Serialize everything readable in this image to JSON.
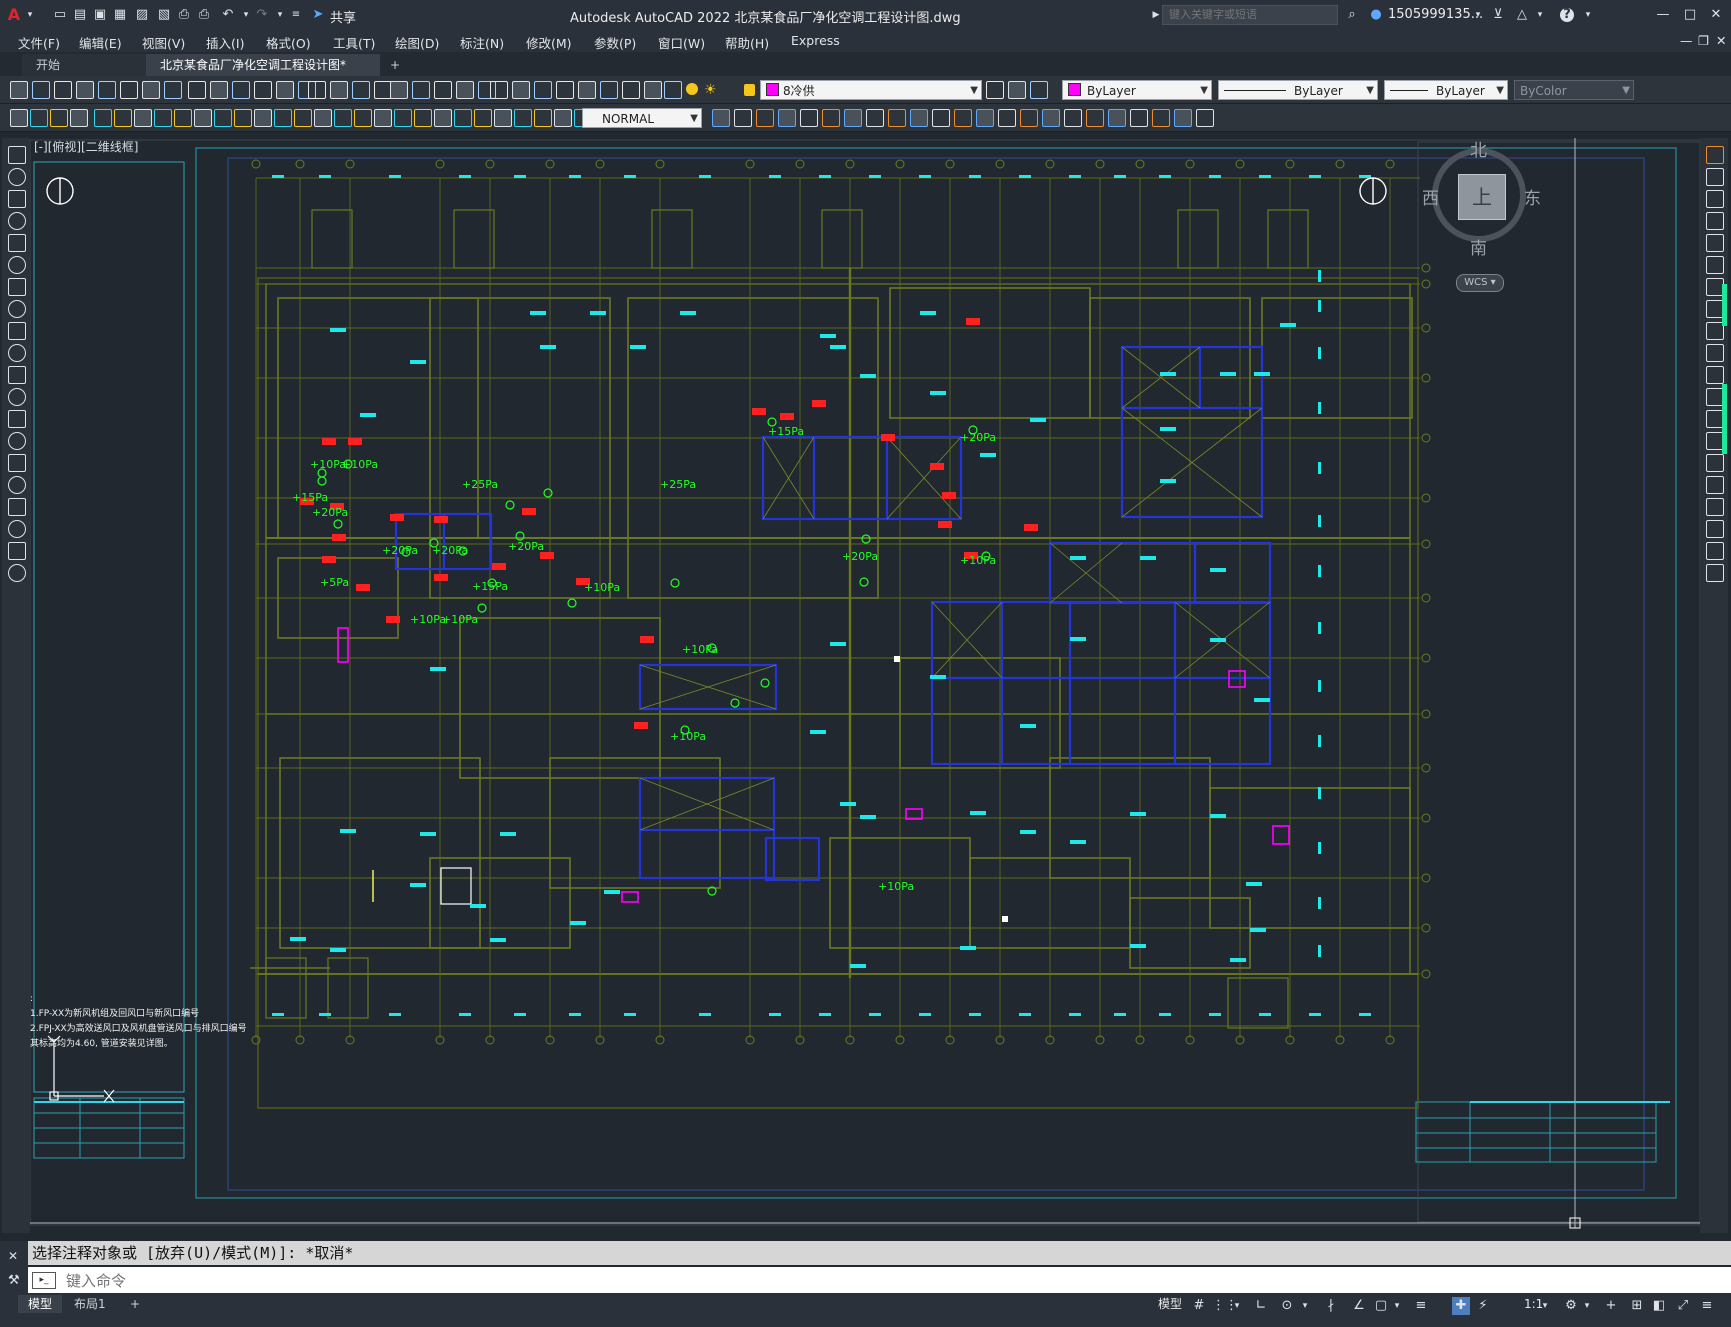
{
  "app": {
    "title": "Autodesk AutoCAD 2022    北京某食品厂净化空调工程设计图.dwg",
    "share_label": "共享",
    "search_placeholder": "键入关键字或短语",
    "user": "1505999135...",
    "accent": "#e0242b"
  },
  "menu": [
    "文件(F)",
    "编辑(E)",
    "视图(V)",
    "插入(I)",
    "格式(O)",
    "工具(T)",
    "绘图(D)",
    "标注(N)",
    "修改(M)",
    "参数(P)",
    "窗口(W)",
    "帮助(H)",
    "Express"
  ],
  "tabs": [
    {
      "label": "开始",
      "active": false
    },
    {
      "label": "北京某食品厂净化空调工程设计图*",
      "active": true
    }
  ],
  "layers_toolbar": {
    "layer": "8冷供",
    "color": "ByLayer",
    "linetype": "ByLayer",
    "lineweight": "ByLayer",
    "plotstyle": "ByColor"
  },
  "dimstyle": "NORMAL",
  "viewport_label": "[-][俯视][二维线框]",
  "viewcube": {
    "north": "北",
    "south": "南",
    "east": "东",
    "west": "西",
    "top": "上",
    "wcs": "WCS"
  },
  "drawing": {
    "pressures": [
      {
        "v": "+10Pa"
      },
      {
        "v": "+10Pa"
      },
      {
        "v": "+15Pa"
      },
      {
        "v": "+20Pa"
      },
      {
        "v": "+25Pa"
      },
      {
        "v": "+25Pa"
      },
      {
        "v": "+20Pa"
      },
      {
        "v": "+20Pa"
      },
      {
        "v": "+20Pa"
      },
      {
        "v": "+15Pa"
      },
      {
        "v": "+5Pa"
      },
      {
        "v": "+10Pa"
      },
      {
        "v": "+10Pa"
      },
      {
        "v": "+10Pa"
      },
      {
        "v": "+20Pa"
      },
      {
        "v": "+15Pa"
      },
      {
        "v": "+20Pa"
      },
      {
        "v": "+10Pa"
      },
      {
        "v": "+10Pa"
      },
      {
        "v": "+10Pa"
      },
      {
        "v": "+10Pa"
      }
    ],
    "notes": [
      ":",
      "1.FP-XX为新风机组及回风口与新风口编号",
      "2.FPJ-XX为高效送风口及风机盘管送风口与排风口编号",
      "  其标高均为4.60, 管道安装见详图。"
    ]
  },
  "command": {
    "history": "选择注释对象或 [放弃(U)/模式(M)]: *取消*",
    "placeholder": "键入命令"
  },
  "layout_tabs": [
    {
      "label": "模型",
      "active": true
    },
    {
      "label": "布局1",
      "active": false
    }
  ],
  "status": {
    "model": "模型",
    "scale": "1:1"
  },
  "icons": [
    "autocad-logo-icon",
    "new-icon",
    "open-icon",
    "save-icon",
    "print-icon",
    "undo-icon",
    "redo-icon",
    "share-icon",
    "search-icon",
    "user-icon",
    "cart-icon",
    "help-icon",
    "minimize-icon",
    "maximize-icon",
    "close-icon",
    "grid-icon",
    "snap-icon",
    "ortho-icon",
    "polar-icon",
    "osnap-icon",
    "gear-icon",
    "plus-icon"
  ]
}
